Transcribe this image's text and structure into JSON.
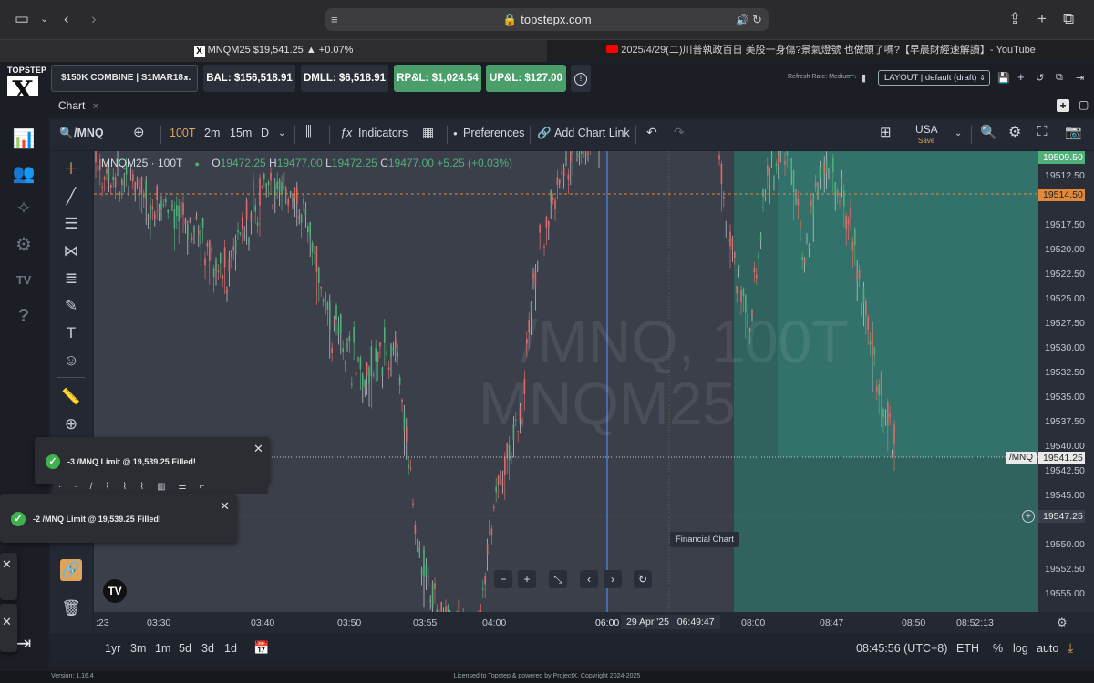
{
  "browser": {
    "url": "topstepx.com",
    "tabs": [
      {
        "label": "MNQM25 $19,541.25 ▲ +0.07%"
      },
      {
        "label": "2025/4/29(二)川普執政百日 美股一身傷?景氣燈號 也做頭了嗎?【早晨財經速解讀】- YouTube"
      }
    ]
  },
  "app": {
    "logo_text": "TOPSTEP",
    "logo_mark": "X",
    "account": "$150K COMBINE | S1MAR18...",
    "stats": {
      "bal": "BAL: $156,518.91",
      "dmll": "DMLL: $6,518.91",
      "rpl": "RP&L: $1,024.54",
      "upl": "UP&L: $127.00"
    },
    "refresh_rate": "Refresh Rate: Medium",
    "layout": "LAYOUT | default (draft)"
  },
  "chart_panel": {
    "tab_label": "Chart",
    "toolbar": {
      "symbol": "/MNQ",
      "intervals": [
        "100T",
        "2m",
        "15m",
        "D"
      ],
      "indicators_label": "Indicators",
      "preferences_label": "Preferences",
      "add_chart_link_label": "Add Chart Link",
      "region": "USA",
      "region_sub": "Save"
    },
    "legend": {
      "symbol": "MNQM25 · 100T",
      "o_label": "O",
      "o": "19472.25",
      "h_label": "H",
      "h": "19477.00",
      "l_label": "L",
      "l": "19472.25",
      "c_label": "C",
      "c": "19477.00",
      "change": "+5.25 (+0.03%)"
    },
    "watermark_line1": "/MNQ, 100T",
    "watermark_line2": "MNQM25",
    "tooltip": "Financial Chart"
  },
  "price_axis": {
    "labels": [
      "19512.50",
      "19517.50",
      "19520.00",
      "19522.50",
      "19525.00",
      "19527.50",
      "19530.00",
      "19532.50",
      "19535.00",
      "19537.50",
      "19540.00",
      "19542.50",
      "19545.00",
      "19550.00",
      "19552.50",
      "19555.00"
    ],
    "tag_top": "19509.50",
    "tag_orange": "19514.50",
    "tag_last": "19541.25",
    "tag_last_symbol": "/MNQ",
    "tag_cursor": "19547.25"
  },
  "time_axis": {
    "labels": [
      ":23",
      "03:30",
      "03:40",
      "03:50",
      "03:55",
      "04:00",
      "06:00",
      "29 Apr '25",
      "06:49:47",
      "08:00",
      "08:47",
      "08:50",
      "08:52:13"
    ]
  },
  "bottom_bar": {
    "ranges": [
      "1yr",
      "3m",
      "1m",
      "5d",
      "3d",
      "1d"
    ],
    "clock": "08:45:56 (UTC+8)",
    "session": "ETH",
    "pct": "%",
    "log": "log",
    "auto": "auto"
  },
  "toasts": [
    {
      "text": "-3 /MNQ Limit @ 19,539.25 Filled!"
    },
    {
      "text": "-2 /MNQ Limit @ 19,539.25 Filled!"
    }
  ],
  "footer": {
    "version": "Version: 1.16.4",
    "license": "Licensed to Topstep & powered by ProjectX. Copyright 2024-2025"
  },
  "colors": {
    "up": "#4fb07a",
    "down": "#e06a6a",
    "position_zone": "#2f6a62",
    "accent_green": "#4a9e6a",
    "orange_line": "#e0893a"
  }
}
